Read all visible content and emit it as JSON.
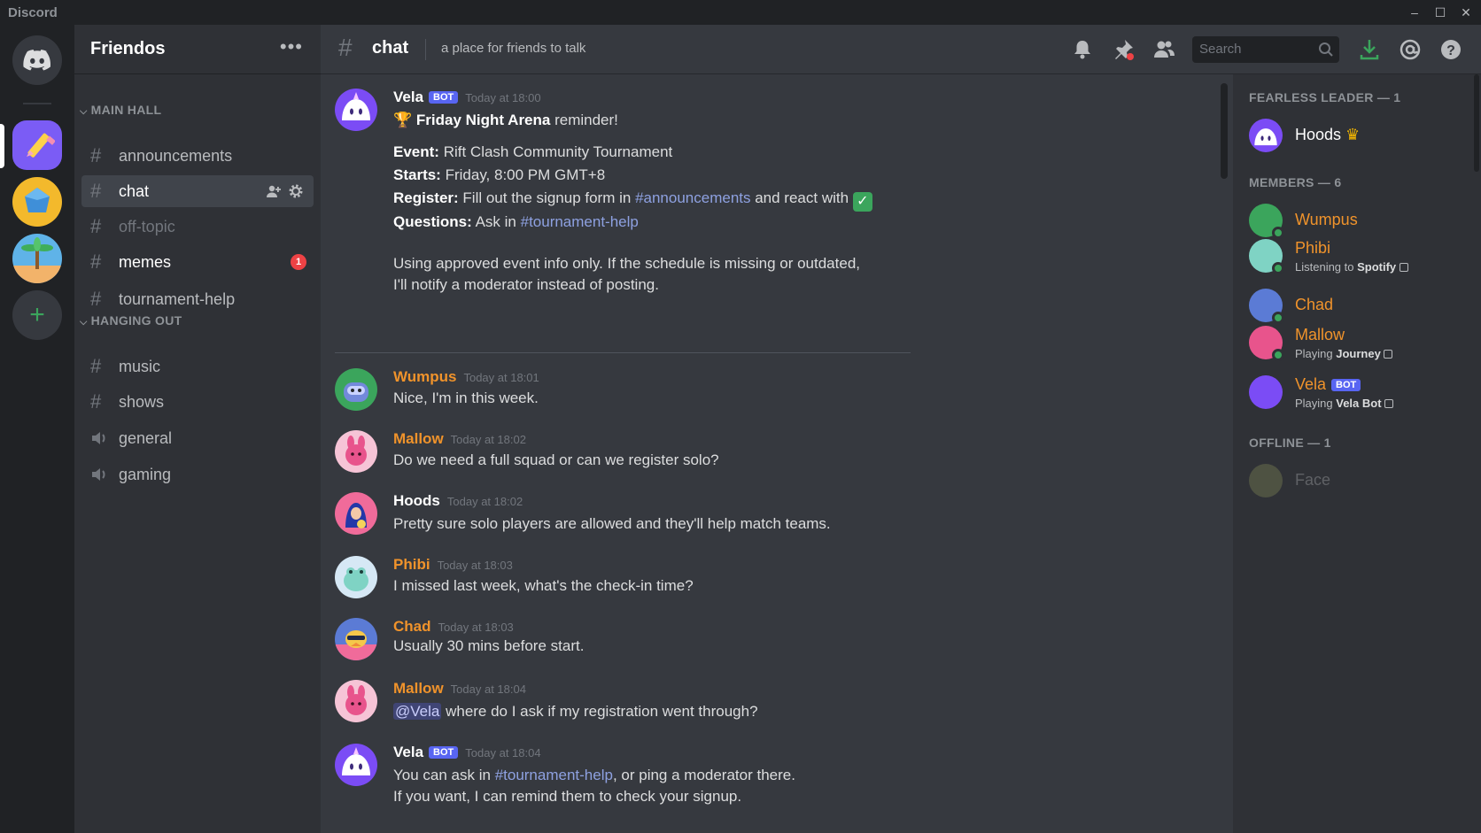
{
  "app": {
    "title": "Discord"
  },
  "window": {
    "minimize": "–",
    "maximize": "☐",
    "close": "✕"
  },
  "colors": {
    "accent": "#5865f2",
    "online": "#3ba55c",
    "orange_role": "#f0932b",
    "mention": "#8ea1e1",
    "unread": "#ed4245"
  },
  "servers": [
    {
      "name": "home",
      "icon": "discord-logo-icon"
    },
    {
      "name": "friendos",
      "icon": "pencil-server-icon"
    },
    {
      "name": "blue-gem",
      "icon": "gem-server-icon"
    },
    {
      "name": "island",
      "icon": "palm-tree-server-icon"
    },
    {
      "name": "add",
      "icon": "plus-icon",
      "label": "+"
    }
  ],
  "sidebar": {
    "server_name": "Friendos",
    "more": "•••",
    "categories": [
      {
        "label": "MAIN HALL",
        "chev": "⌵"
      },
      {
        "label": "HANGING OUT",
        "chev": "⌵"
      }
    ],
    "channels": [
      {
        "name": "announcements",
        "icon": "#"
      },
      {
        "name": "chat",
        "icon": "#"
      },
      {
        "name": "off-topic",
        "icon": "#"
      },
      {
        "name": "memes",
        "icon": "#",
        "badge": "1"
      },
      {
        "name": "tournament-help",
        "icon": "#"
      },
      {
        "name": "music",
        "icon": "#"
      },
      {
        "name": "shows",
        "icon": "#"
      },
      {
        "name": "general",
        "icon": "🔈"
      },
      {
        "name": "gaming",
        "icon": "🔈"
      }
    ]
  },
  "header": {
    "hash": "#",
    "channel": "chat",
    "topic": "a place for friends to talk",
    "search_placeholder": "Search"
  },
  "messages": [
    {
      "user": "Vela",
      "bot": "BOT",
      "time": "Today at 18:00",
      "trophy": "🏆",
      "title_bold": "Friday Night Arena",
      "title_rest": " reminder!",
      "lines": [
        {
          "label": "Event:",
          "text": " Rift Clash Community Tournament"
        },
        {
          "label": "Starts:",
          "text": " Friday, 8:00 PM GMT+8"
        },
        {
          "label": "Register:",
          "text": " Fill out the signup form in ",
          "link": "#announcements",
          "after": " and react with ",
          "check": "✓"
        },
        {
          "label": "Questions:",
          "text": " Ask in ",
          "link": "#tournament-help"
        }
      ],
      "note_1": "Using approved event info only. If the schedule is missing or outdated,",
      "note_2": "I'll notify a moderator instead of posting."
    },
    {
      "user": "Wumpus",
      "time": "Today at 18:01",
      "text": "Nice, I'm in this week."
    },
    {
      "user": "Mallow",
      "time": "Today at 18:02",
      "text": "Do we need a full squad or can we register solo?"
    },
    {
      "user": "Hoods",
      "time": "Today at 18:02",
      "text": "Pretty sure solo players are allowed and they'll help match teams."
    },
    {
      "user": "Phibi",
      "time": "Today at 18:03",
      "text": "I missed last week, what's the check-in time?"
    },
    {
      "user": "Chad",
      "time": "Today at 18:03",
      "text": "Usually 30 mins before start."
    },
    {
      "user": "Mallow",
      "time": "Today at 18:04",
      "mention": "@Vela",
      "text": " where do I ask if my registration went through?"
    },
    {
      "user": "Vela",
      "bot": "BOT",
      "time": "Today at 18:04",
      "text_a": "You can ask in ",
      "link": "#tournament-help",
      "text_b": ", or ping a moderator there.",
      "line2": "If you want, I can remind them to check your signup."
    }
  ],
  "members": {
    "leader_header": "FEARLESS LEADER — 1",
    "members_header": "MEMBERS — 6",
    "offline_header": "OFFLINE — 1",
    "leader": {
      "name": "Hoods",
      "crown": "♛"
    },
    "list": [
      {
        "name": "Wumpus"
      },
      {
        "name": "Phibi",
        "status_prefix": "Listening to ",
        "status_bold": "Spotify"
      },
      {
        "name": "Chad"
      },
      {
        "name": "Mallow",
        "status_prefix": "Playing ",
        "status_bold": "Journey"
      },
      {
        "name": "Vela",
        "bot": "BOT",
        "status_prefix": "Playing ",
        "status_bold": "Vela Bot"
      }
    ],
    "offline": {
      "name": "Face"
    }
  }
}
